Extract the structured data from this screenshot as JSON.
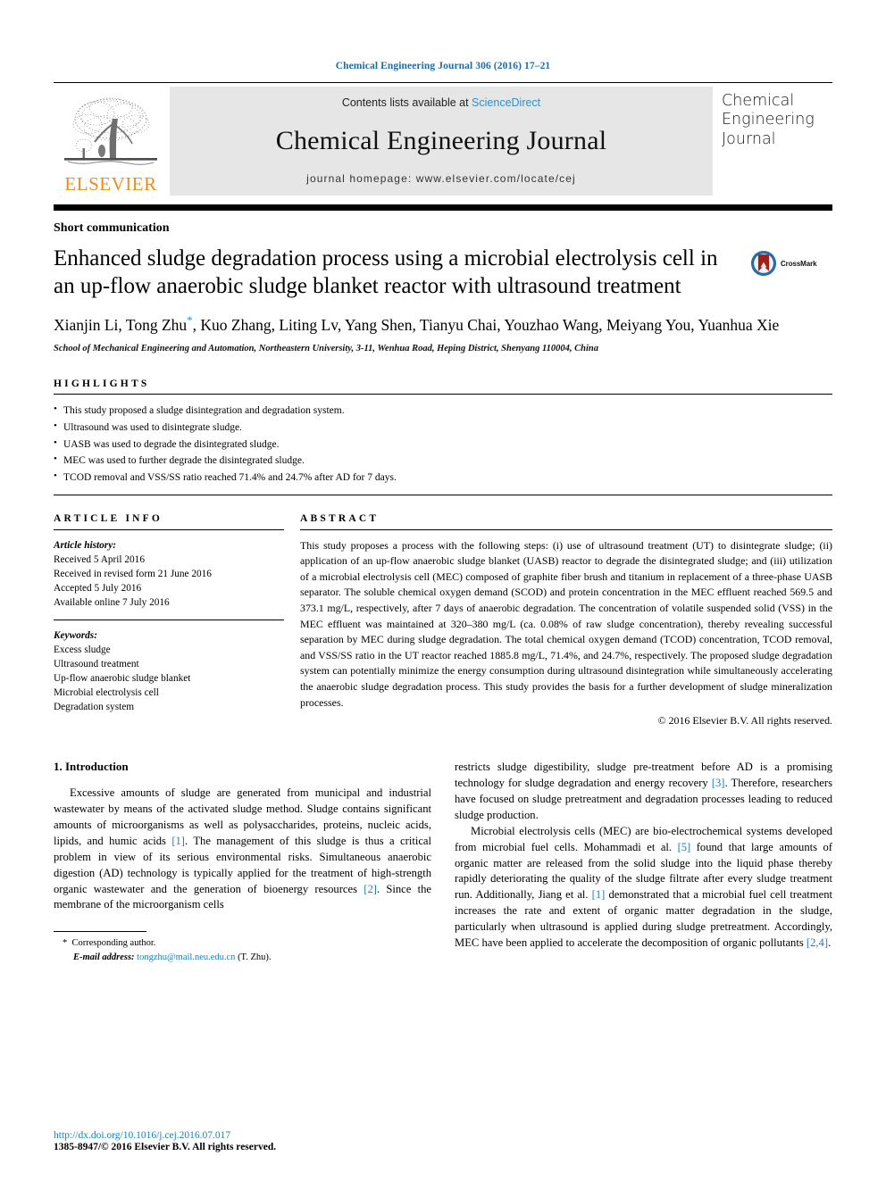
{
  "running_head": "Chemical Engineering Journal 306 (2016) 17–21",
  "masthead": {
    "contents_prefix": "Contents lists available at ",
    "sciencedirect": "ScienceDirect",
    "journal_title": "Chemical Engineering Journal",
    "homepage": "journal homepage: www.elsevier.com/locate/cej",
    "publisher_word": "ELSEVIER",
    "cover_line1": "Chemical",
    "cover_line2": "Engineering",
    "cover_line3": "Journal",
    "link_color": "#2f8fd0",
    "publisher_color": "#f08c1a",
    "box_bg": "#e6e6e6"
  },
  "article": {
    "kind": "Short communication",
    "title": "Enhanced sludge degradation process using a microbial electrolysis cell in an up-flow anaerobic sludge blanket reactor with ultrasound treatment",
    "crossmark_label": "CrossMark",
    "authors": "Xianjin Li, Tong Zhu",
    "authors_rest": ", Kuo Zhang, Liting Lv, Yang Shen, Tianyu Chai, Youzhao Wang, Meiyang You, Yuanhua Xie",
    "corresponding_marker": "*",
    "affiliation": "School of Mechanical Engineering and Automation, Northeastern University, 3-11, Wenhua Road, Heping District, Shenyang 110004, China"
  },
  "highlights": {
    "label": "HIGHLIGHTS",
    "items": [
      "This study proposed a sludge disintegration and degradation system.",
      "Ultrasound was used to disintegrate sludge.",
      "UASB was used to degrade the disintegrated sludge.",
      "MEC was used to further degrade the disintegrated sludge.",
      "TCOD removal and VSS/SS ratio reached 71.4% and 24.7% after AD for 7 days."
    ]
  },
  "article_info": {
    "label": "ARTICLE INFO",
    "history_head": "Article history:",
    "history": [
      "Received 5 April 2016",
      "Received in revised form 21 June 2016",
      "Accepted 5 July 2016",
      "Available online 7 July 2016"
    ],
    "keywords_head": "Keywords:",
    "keywords": [
      "Excess sludge",
      "Ultrasound treatment",
      "Up-flow anaerobic sludge blanket",
      "Microbial electrolysis cell",
      "Degradation system"
    ]
  },
  "abstract": {
    "label": "ABSTRACT",
    "text": "This study proposes a process with the following steps: (i) use of ultrasound treatment (UT) to disintegrate sludge; (ii) application of an up-flow anaerobic sludge blanket (UASB) reactor to degrade the disintegrated sludge; and (iii) utilization of a microbial electrolysis cell (MEC) composed of graphite fiber brush and titanium in replacement of a three-phase UASB separator. The soluble chemical oxygen demand (SCOD) and protein concentration in the MEC effluent reached 569.5 and 373.1 mg/L, respectively, after 7 days of anaerobic degradation. The concentration of volatile suspended solid (VSS) in the MEC effluent was maintained at 320–380 mg/L (ca. 0.08% of raw sludge concentration), thereby revealing successful separation by MEC during sludge degradation. The total chemical oxygen demand (TCOD) concentration, TCOD removal, and VSS/SS ratio in the UT reactor reached 1885.8 mg/L, 71.4%, and 24.7%, respectively. The proposed sludge degradation system can potentially minimize the energy consumption during ultrasound disintegration while simultaneously accelerating the anaerobic sludge degradation process. This study provides the basis for a further development of sludge mineralization processes.",
    "copyright": "© 2016 Elsevier B.V. All rights reserved."
  },
  "introduction": {
    "heading": "1. Introduction",
    "left_p1_a": "Excessive amounts of sludge are generated from municipal and industrial wastewater by means of the activated sludge method. Sludge contains significant amounts of microorganisms as well as polysaccharides, proteins, nucleic acids, lipids, and humic acids ",
    "left_ref1": "[1]",
    "left_p1_b": ". The management of this sludge is thus a critical problem in view of its serious environmental risks. Simultaneous anaerobic digestion (AD) technology is typically applied for the treatment of high-strength organic wastewater and the generation of bioenergy resources ",
    "left_ref2": "[2]",
    "left_p1_c": ". Since the membrane of the microorganism cells",
    "right_p1_a": "restricts sludge digestibility, sludge pre-treatment before AD is a promising technology for sludge degradation and energy recovery ",
    "right_ref3": "[3]",
    "right_p1_b": ". Therefore, researchers have focused on sludge pretreatment and degradation processes leading to reduced sludge production.",
    "right_p2_a": "Microbial electrolysis cells (MEC) are bio-electrochemical systems developed from microbial fuel cells. Mohammadi et al. ",
    "right_ref5": "[5]",
    "right_p2_b": " found that large amounts of organic matter are released from the solid sludge into the liquid phase thereby rapidly deteriorating the quality of the sludge filtrate after every sludge treatment run. Additionally, Jiang et al. ",
    "right_ref1": "[1]",
    "right_p2_c": " demonstrated that a microbial fuel cell treatment increases the rate and extent of organic matter degradation in the sludge, particularly when ultrasound is applied during sludge pretreatment. Accordingly, MEC have been applied to accelerate the decomposition of organic pollutants ",
    "right_ref24": "[2,4]",
    "right_p2_d": "."
  },
  "footnote": {
    "marker": "*",
    "corresponding": "Corresponding author.",
    "email_label": "E-mail address:",
    "email": "tongzhu@mail.neu.edu.cn",
    "email_suffix": "(T. Zhu)."
  },
  "footer": {
    "doi": "http://dx.doi.org/10.1016/j.cej.2016.07.017",
    "issn": "1385-8947/© 2016 Elsevier B.V. All rights reserved."
  }
}
